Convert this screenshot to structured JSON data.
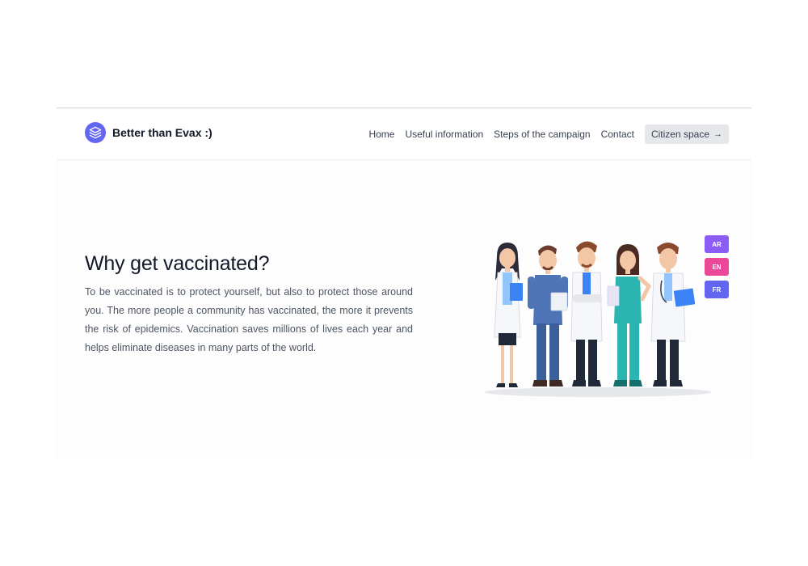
{
  "brand": {
    "name": "Better than Evax :)",
    "logo_icon": "layers-icon",
    "accent": "#6366f1"
  },
  "nav": {
    "items": [
      {
        "label": "Home"
      },
      {
        "label": "Useful information"
      },
      {
        "label": "Steps of the campaign"
      },
      {
        "label": "Contact"
      }
    ],
    "cta": {
      "label": "Citizen space",
      "icon": "arrow-right-icon"
    }
  },
  "hero": {
    "title": "Why get vaccinated?",
    "text": "To be vaccinated is to protect yourself, but also to protect those around you. The more people a community has vaccinated, the more it prevents the risk of epidemics. Vaccination saves millions of lives each year and helps eliminate diseases in many parts of the world.",
    "illustration": "medical-team-illustration"
  },
  "languages": [
    {
      "code": "AR",
      "color": "#8b5cf6"
    },
    {
      "code": "EN",
      "color": "#ec4899"
    },
    {
      "code": "FR",
      "color": "#6366f1"
    }
  ]
}
